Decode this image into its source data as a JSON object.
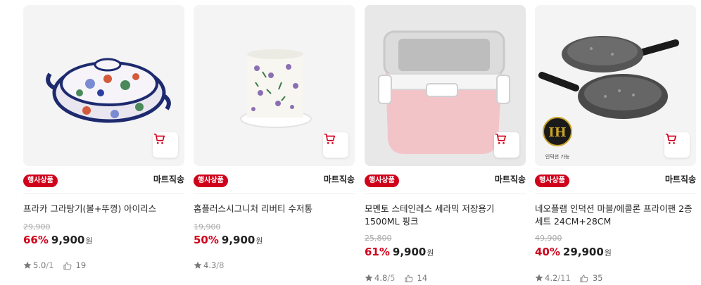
{
  "accent": "#d0021b",
  "products": [
    {
      "badge": "행사상품",
      "shipping": "마트직송",
      "name": "프라카 그라탕기(볼+뚜껑) 아이리스",
      "original_price": "29,900",
      "discount": "66%",
      "price": "9,900",
      "currency": "원",
      "rating": "5.0",
      "review_count": "/1",
      "likes": "19"
    },
    {
      "badge": "행사상품",
      "shipping": "마트직송",
      "name": "홈플러스시그니처 리버티 수저통",
      "original_price": "19,900",
      "discount": "50%",
      "price": "9,900",
      "currency": "원",
      "rating": "4.3",
      "review_count": "/8",
      "likes": ""
    },
    {
      "badge": "행사상품",
      "shipping": "마트직송",
      "name": "모멘토 스테인레스 세라믹 저장용기 1500ML 핑크",
      "original_price": "25,800",
      "discount": "61%",
      "price": "9,900",
      "currency": "원",
      "rating": "4.8",
      "review_count": "/5",
      "likes": "14"
    },
    {
      "badge": "행사상품",
      "shipping": "마트직송",
      "name": "네오플램 인덕션 마블/에콜론 프라이팬 2종 세트 24CM+28CM",
      "original_price": "49,900",
      "discount": "40%",
      "price": "29,900",
      "currency": "원",
      "rating": "4.2",
      "review_count": "/11",
      "likes": "35",
      "image_label_mark": "IH",
      "image_label_text": "인덕션 가능"
    }
  ]
}
